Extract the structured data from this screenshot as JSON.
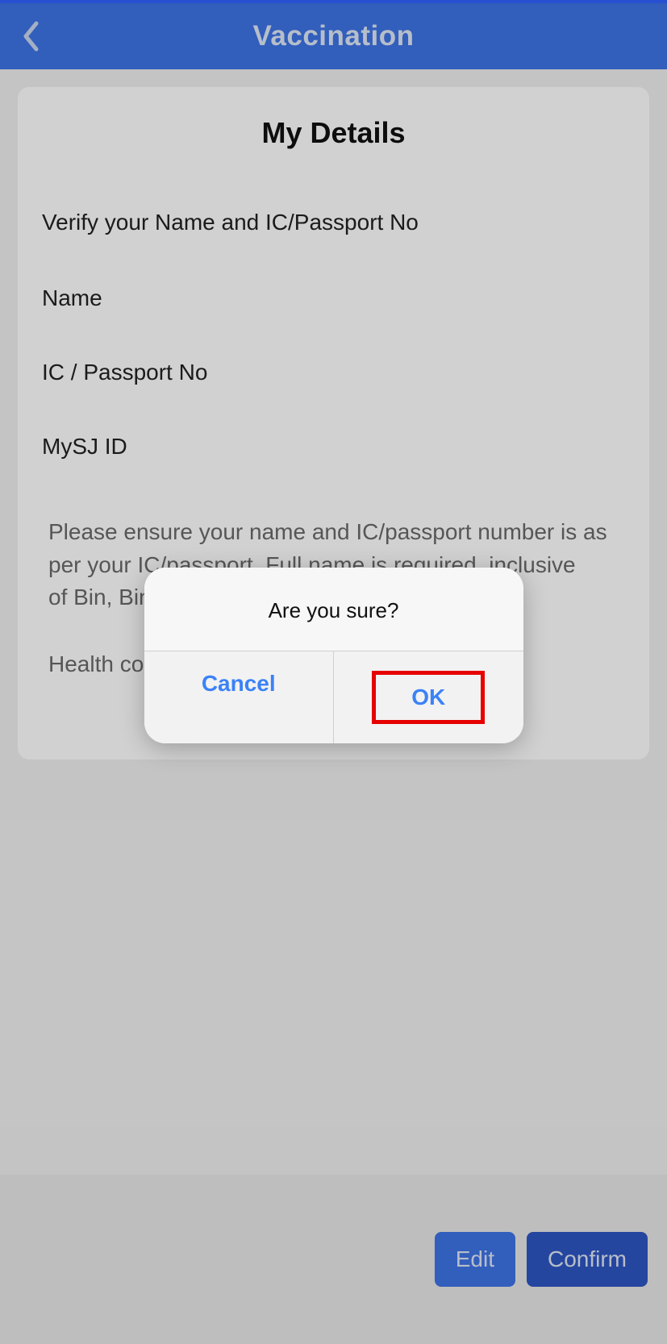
{
  "header": {
    "title": "Vaccination"
  },
  "card": {
    "title": "My Details",
    "verify_text": "Verify your Name and IC/Passport No",
    "name_label": "Name",
    "ic_label": "IC / Passport No",
    "mysj_label": "MySJ ID",
    "note_line1": "Please ensure your name and IC/passport number is as",
    "note_line2": "per your IC/passport. Full name is required, inclusive",
    "note_line3": "of Bin, Binti, etc.",
    "health_text": "Health conditions"
  },
  "dialog": {
    "message": "Are you sure?",
    "cancel_label": "Cancel",
    "ok_label": "OK"
  },
  "footer": {
    "edit_label": "Edit",
    "confirm_label": "Confirm"
  }
}
